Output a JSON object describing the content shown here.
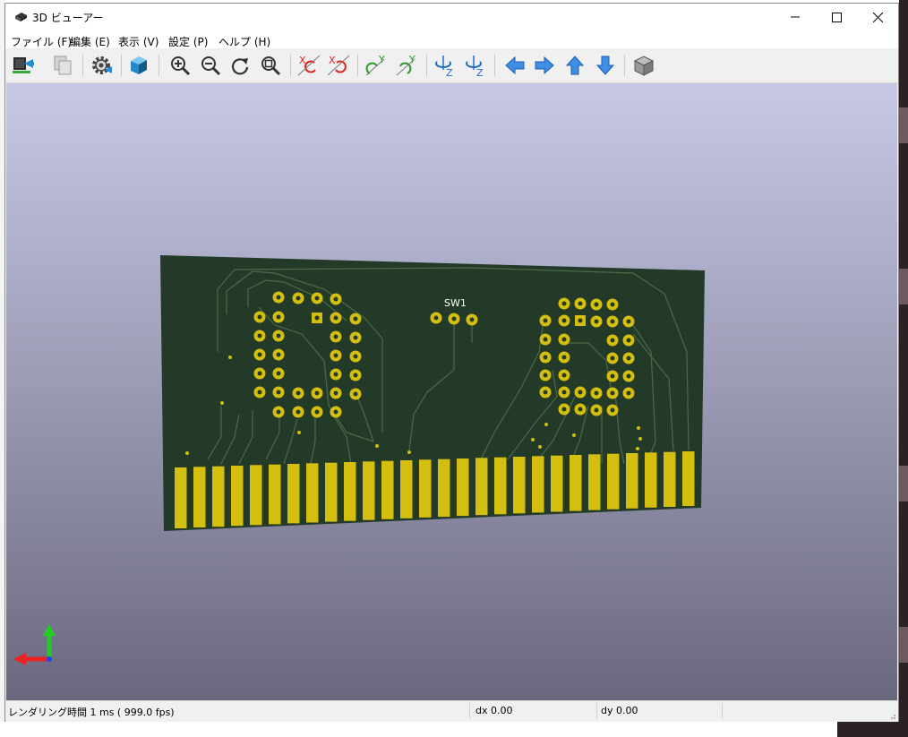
{
  "window": {
    "title": "3D ビューアー",
    "minimize_icon": "minimize-icon",
    "maximize_icon": "maximize-icon",
    "close_icon": "close-icon"
  },
  "menu": {
    "items": [
      {
        "label": "ファイル (F)"
      },
      {
        "label": "編集 (E)"
      },
      {
        "label": "表示 (V)"
      },
      {
        "label": "設定 (P)"
      },
      {
        "label": "ヘルプ (H)"
      }
    ]
  },
  "toolbar": {
    "buttons": [
      {
        "icon": "reload-board-icon"
      },
      {
        "icon": "copy-image-icon"
      },
      {
        "icon": "settings-gear-icon"
      },
      {
        "icon": "raytracing-cube-icon"
      },
      {
        "icon": "zoom-in-icon"
      },
      {
        "icon": "zoom-out-icon"
      },
      {
        "icon": "redraw-icon"
      },
      {
        "icon": "zoom-fit-icon"
      },
      {
        "icon": "rotate-x-cw-icon",
        "label": "X"
      },
      {
        "icon": "rotate-x-ccw-icon",
        "label": "X"
      },
      {
        "icon": "rotate-y-cw-icon",
        "label": "Y"
      },
      {
        "icon": "rotate-y-ccw-icon",
        "label": "Y"
      },
      {
        "icon": "rotate-z-cw-icon",
        "label": "Z"
      },
      {
        "icon": "rotate-z-ccw-icon",
        "label": "Z"
      },
      {
        "icon": "pan-left-icon"
      },
      {
        "icon": "pan-right-icon"
      },
      {
        "icon": "pan-up-icon"
      },
      {
        "icon": "pan-down-icon"
      },
      {
        "icon": "ortho-projection-icon"
      }
    ]
  },
  "viewport": {
    "board_label": "SW1",
    "axis_icon": "axis-indicator-icon",
    "colors": {
      "board": "#233a28",
      "copper_pad": "#d4be10",
      "trace": "#4c6a48",
      "silkscreen": "#ffffff"
    }
  },
  "status": {
    "render": "レンダリング時間 1 ms ( 999.0 fps)",
    "dx": "dx 0.00",
    "dy": "dy 0.00"
  }
}
